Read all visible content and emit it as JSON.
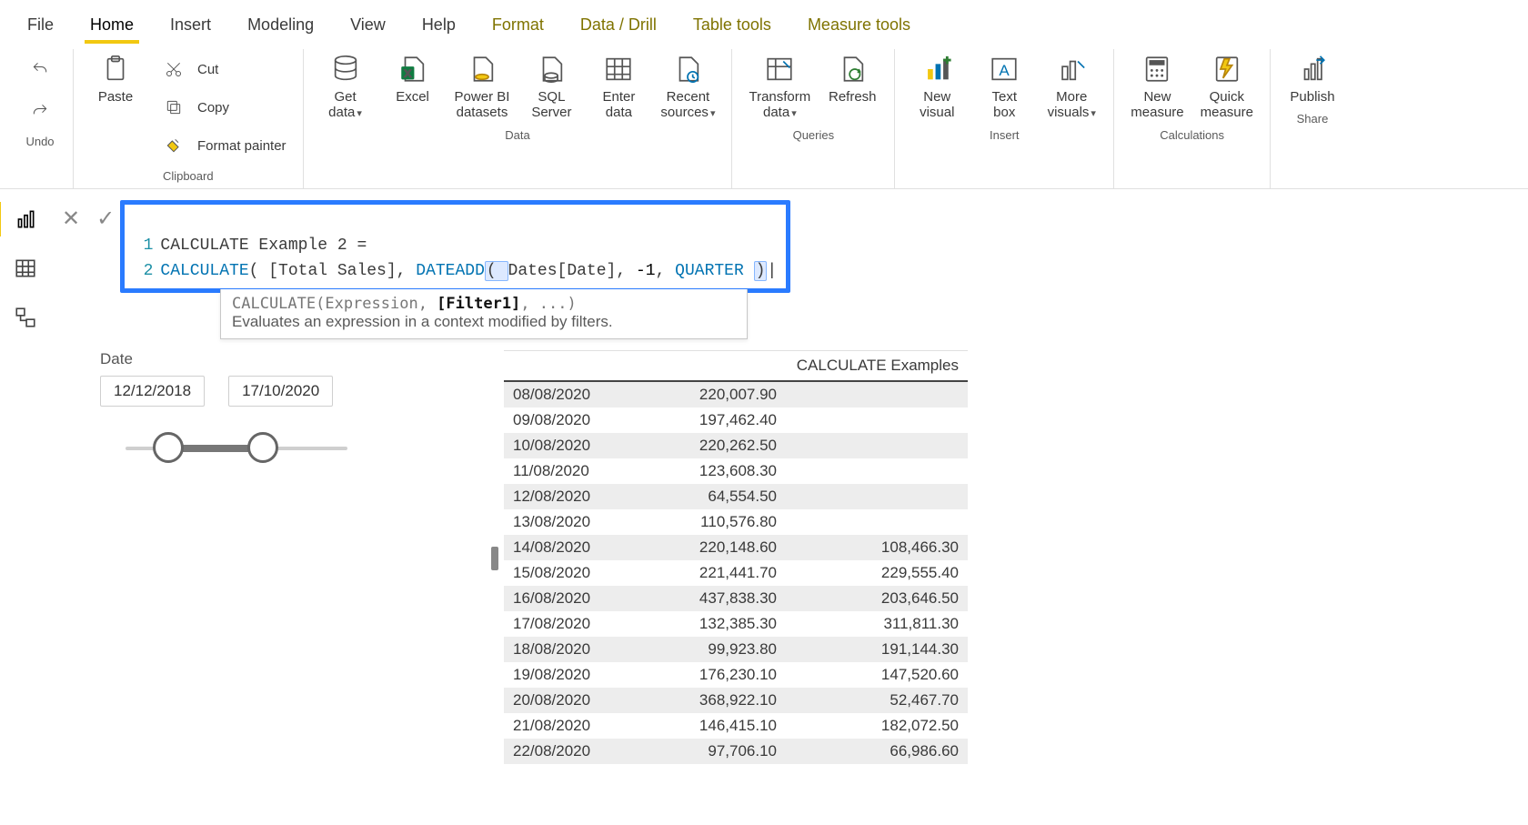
{
  "tabs": {
    "file": "File",
    "home": "Home",
    "insert": "Insert",
    "modeling": "Modeling",
    "view": "View",
    "help": "Help",
    "format": "Format",
    "data_drill": "Data / Drill",
    "table_tools": "Table tools",
    "measure_tools": "Measure tools"
  },
  "ribbon": {
    "undo_group": "Undo",
    "clipboard_group": "Clipboard",
    "paste": "Paste",
    "cut": "Cut",
    "copy": "Copy",
    "format_painter": "Format painter",
    "data_group": "Data",
    "get_data": "Get\ndata",
    "excel": "Excel",
    "pbi_datasets": "Power BI\ndatasets",
    "sql_server": "SQL\nServer",
    "enter_data": "Enter\ndata",
    "recent_sources": "Recent\nsources",
    "queries_group": "Queries",
    "transform": "Transform\ndata",
    "refresh": "Refresh",
    "insert_group": "Insert",
    "new_visual": "New\nvisual",
    "text_box": "Text\nbox",
    "more_visuals": "More\nvisuals",
    "calc_group": "Calculations",
    "new_measure": "New\nmeasure",
    "quick_measure": "Quick\nmeasure",
    "share_group": "Share",
    "publish": "Publish"
  },
  "formula": {
    "line1_num": "1",
    "line1_text": "CALCULATE Example 2 =",
    "line2_num": "2",
    "line2_tokens": {
      "calc": "CALCULATE",
      "open": "( ",
      "measure": "[Total Sales]",
      "sep1": ", ",
      "dateadd": "DATEADD",
      "dopen": "( ",
      "col": "Dates[Date]",
      "sep2": ", ",
      "neg1": "-1",
      "sep3": ", ",
      "quarter": "QUARTER ",
      "close": ")",
      "cursor": "|"
    }
  },
  "intellisense": {
    "sig_prefix": "CALCULATE(Expression, ",
    "sig_bold": "[Filter1]",
    "sig_suffix": ", ...)",
    "desc": "Evaluates an expression in a context modified by filters."
  },
  "slicer": {
    "title": "Date",
    "from": "12/12/2018",
    "to": "17/10/2020"
  },
  "table": {
    "col3_header": "CALCULATE Examples",
    "rows": [
      {
        "d": "08/08/2020",
        "v1": "220,007.90",
        "v2": ""
      },
      {
        "d": "09/08/2020",
        "v1": "197,462.40",
        "v2": ""
      },
      {
        "d": "10/08/2020",
        "v1": "220,262.50",
        "v2": ""
      },
      {
        "d": "11/08/2020",
        "v1": "123,608.30",
        "v2": ""
      },
      {
        "d": "12/08/2020",
        "v1": "64,554.50",
        "v2": ""
      },
      {
        "d": "13/08/2020",
        "v1": "110,576.80",
        "v2": ""
      },
      {
        "d": "14/08/2020",
        "v1": "220,148.60",
        "v2": "108,466.30"
      },
      {
        "d": "15/08/2020",
        "v1": "221,441.70",
        "v2": "229,555.40"
      },
      {
        "d": "16/08/2020",
        "v1": "437,838.30",
        "v2": "203,646.50"
      },
      {
        "d": "17/08/2020",
        "v1": "132,385.30",
        "v2": "311,811.30"
      },
      {
        "d": "18/08/2020",
        "v1": "99,923.80",
        "v2": "191,144.30"
      },
      {
        "d": "19/08/2020",
        "v1": "176,230.10",
        "v2": "147,520.60"
      },
      {
        "d": "20/08/2020",
        "v1": "368,922.10",
        "v2": "52,467.70"
      },
      {
        "d": "21/08/2020",
        "v1": "146,415.10",
        "v2": "182,072.50"
      },
      {
        "d": "22/08/2020",
        "v1": "97,706.10",
        "v2": "66,986.60"
      }
    ]
  }
}
